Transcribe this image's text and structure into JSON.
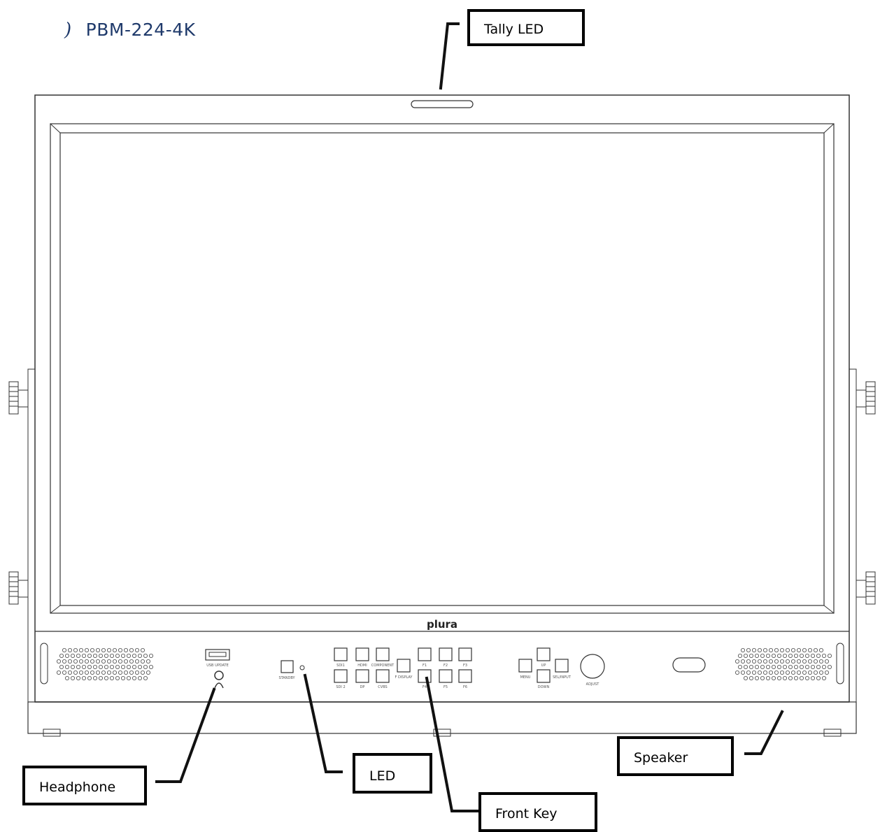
{
  "title": {
    "glyph": ")",
    "model": "PBM-224-4K"
  },
  "brand_logo": "plura",
  "callouts": {
    "tally_led": "Tally LED",
    "headphone": "Headphone",
    "led": "LED",
    "front_key": "Front Key",
    "speaker": "Speaker"
  },
  "panel_labels": {
    "usb_update": "USB UPDATE",
    "standby": "STANDBY",
    "sdi1": "SDI1",
    "hdmi": "HDMI",
    "component": "COMPONENT",
    "sdi2": "SDI 2",
    "dp": "DP",
    "cvbs": "CVBS",
    "f_display": "F DISPLAY",
    "f1": "F1",
    "f2": "F2",
    "f3": "F3",
    "f4": "F4",
    "f5": "F5",
    "f6": "F6",
    "menu": "MENU",
    "up": "UP",
    "down": "DOWN",
    "sel_input": "SEL/INPUT",
    "adjust": "ADJUST"
  },
  "colors": {
    "title": "#1f3a6b",
    "line": "#333333"
  }
}
